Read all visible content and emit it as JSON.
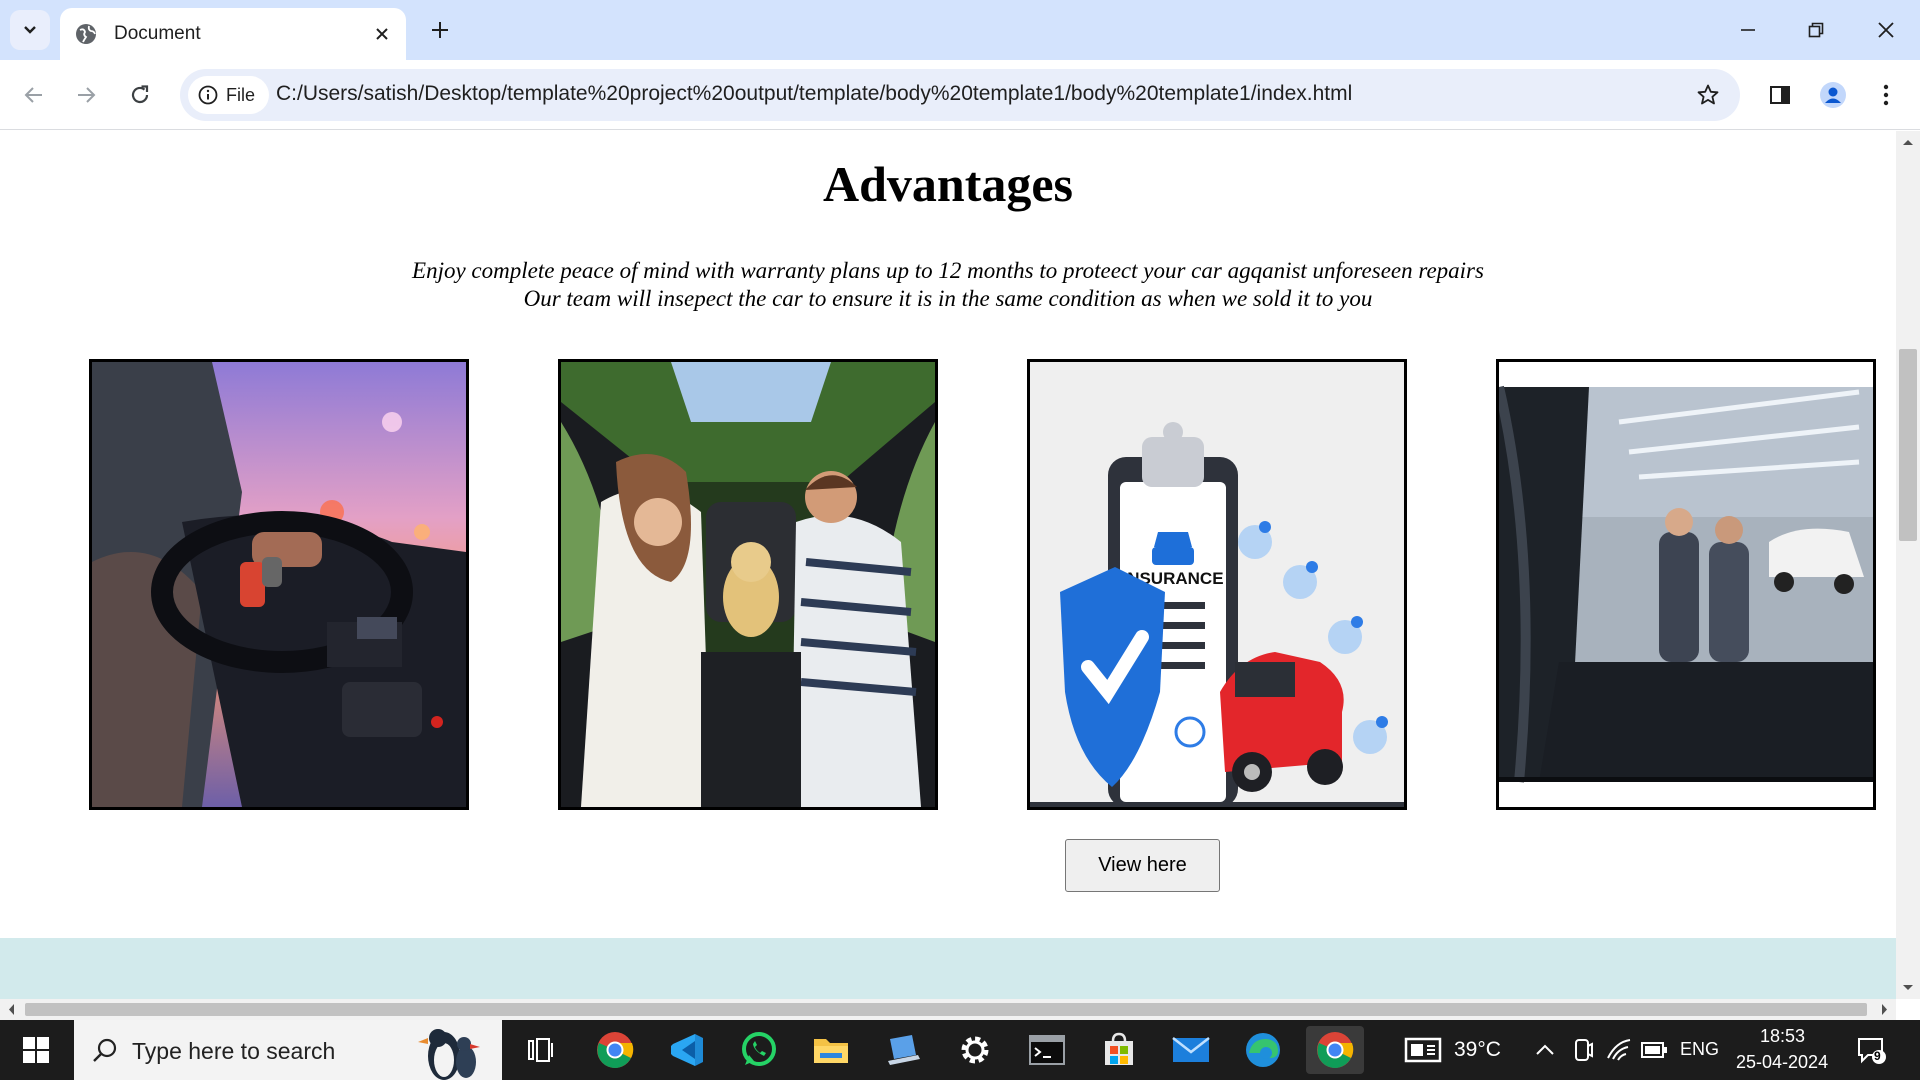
{
  "browser": {
    "tab_title": "Document",
    "address_chip": "File",
    "url": "C:/Users/satish/Desktop/template%20project%20output/template/body%20template1/body%20template1/index.html"
  },
  "page": {
    "heading": "Advantages",
    "subtext_line1": "Enjoy complete peace of mind with warranty plans up to 12 months to proteect your car agqanist unforeseen repairs",
    "subtext_line2": "Our team will insepect the car to ensure it is in the same condition as when we sold it to you",
    "cards": [
      {
        "image": "driver-dashboard-photo"
      },
      {
        "image": "family-in-car-photo"
      },
      {
        "image": "insurance-illustration",
        "label": "INSURANCE"
      },
      {
        "image": "service-garage-photo"
      }
    ],
    "button_label": "View here"
  },
  "taskbar": {
    "search_placeholder": "Type here to search",
    "weather": "39°C",
    "language": "ENG",
    "time": "18:53",
    "date": "25-04-2024",
    "notification_count": "9"
  },
  "colors": {
    "titlebar": "#d3e3fd",
    "teal_band": "#d2eaec",
    "taskbar": "#1c1c1c"
  }
}
